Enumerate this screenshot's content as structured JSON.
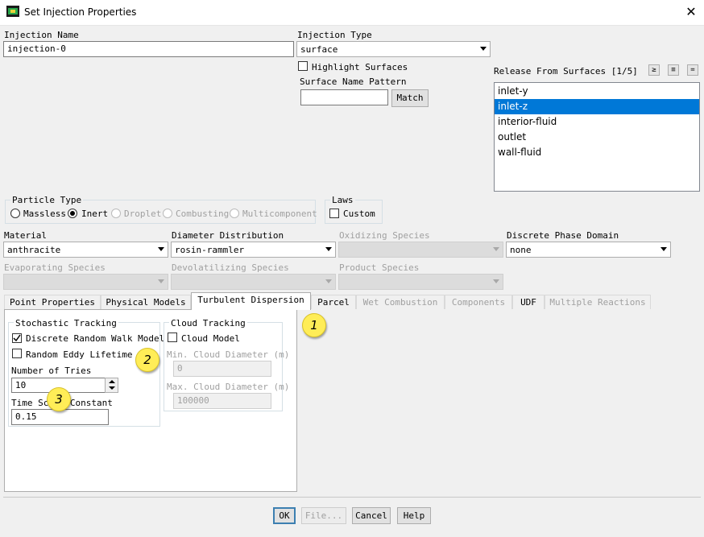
{
  "window": {
    "title": "Set Injection Properties",
    "close_glyph": "✕"
  },
  "injection_name": {
    "label": "Injection Name",
    "value": "injection-0"
  },
  "injection_type": {
    "label": "Injection Type",
    "value": "surface"
  },
  "highlight_surfaces": {
    "label": "Highlight Surfaces",
    "checked": false
  },
  "surface_name_pattern": {
    "label": "Surface Name Pattern",
    "value": "",
    "match_label": "Match"
  },
  "release_from_surfaces": {
    "label": "Release From Surfaces [1/5]",
    "tool_icons": [
      "select-all-icon",
      "deselect-all-icon",
      "filter-icon"
    ],
    "tool_glyphs": [
      "≥",
      "≡",
      "="
    ],
    "items": [
      "inlet-y",
      "inlet-z",
      "interior-fluid",
      "outlet",
      "wall-fluid"
    ],
    "selected": "inlet-z"
  },
  "particle_type": {
    "label": "Particle Type",
    "options": [
      "Massless",
      "Inert",
      "Droplet",
      "Combusting",
      "Multicomponent"
    ],
    "selected": "Inert"
  },
  "laws": {
    "label": "Laws",
    "custom_label": "Custom",
    "custom_checked": false
  },
  "material": {
    "label": "Material",
    "value": "anthracite"
  },
  "diameter_distribution": {
    "label": "Diameter Distribution",
    "value": "rosin-rammler"
  },
  "oxidizing_species": {
    "label": "Oxidizing Species",
    "value": ""
  },
  "discrete_phase_domain": {
    "label": "Discrete Phase Domain",
    "value": "none"
  },
  "evaporating_species": {
    "label": "Evaporating Species",
    "value": ""
  },
  "devolatilizing_species": {
    "label": "Devolatilizing Species",
    "value": ""
  },
  "product_species": {
    "label": "Product Species",
    "value": ""
  },
  "tabs": [
    "Point Properties",
    "Physical Models",
    "Turbulent Dispersion",
    "Parcel",
    "Wet Combustion",
    "Components",
    "UDF",
    "Multiple Reactions"
  ],
  "active_tab": "Turbulent Dispersion",
  "stochastic_tracking": {
    "label": "Stochastic Tracking",
    "discrete_random_walk": {
      "label": "Discrete Random Walk Model",
      "checked": true
    },
    "random_eddy_lifetime": {
      "label": "Random Eddy Lifetime",
      "checked": false
    },
    "number_of_tries": {
      "label": "Number of Tries",
      "value": "10"
    },
    "time_scale_constant": {
      "label": "Time Scale Constant",
      "value": "0.15"
    }
  },
  "cloud_tracking": {
    "label": "Cloud Tracking",
    "cloud_model": {
      "label": "Cloud Model",
      "checked": false
    },
    "min_cloud_diameter": {
      "label": "Min. Cloud Diameter (m)",
      "value": "0"
    },
    "max_cloud_diameter": {
      "label": "Max. Cloud Diameter (m)",
      "value": "100000"
    }
  },
  "callouts": [
    "1",
    "2",
    "3"
  ],
  "buttons": {
    "ok": "OK",
    "file": "File...",
    "cancel": "Cancel",
    "help": "Help"
  },
  "colors": {
    "selection": "#0078d7",
    "callout": "#ffed57",
    "default_button_border": "#3c7fb1"
  }
}
